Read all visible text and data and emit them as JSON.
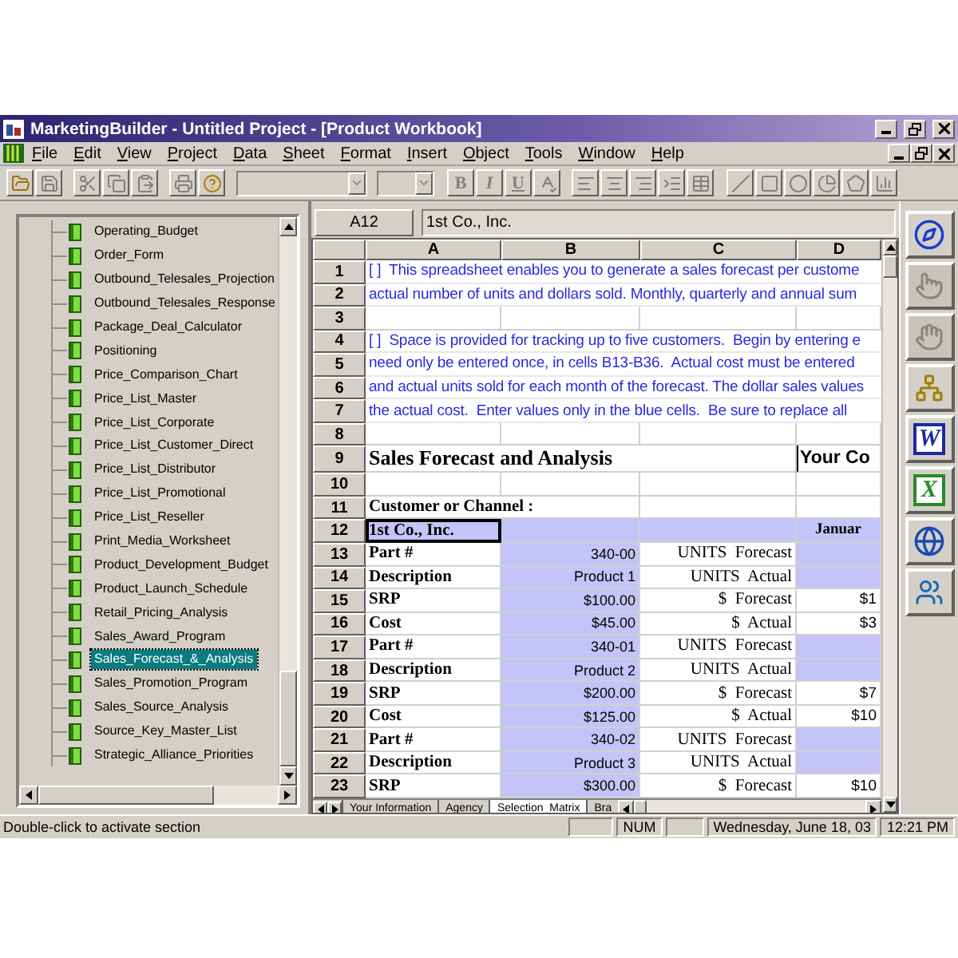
{
  "window": {
    "title": "MarketingBuilder - Untitled Project - [Product Workbook]"
  },
  "menu": [
    "File",
    "Edit",
    "View",
    "Project",
    "Data",
    "Sheet",
    "Format",
    "Insert",
    "Object",
    "Tools",
    "Window",
    "Help"
  ],
  "format_buttons": [
    "B",
    "I",
    "U"
  ],
  "sections": [
    {
      "label": "Operating_Budget",
      "selected": false
    },
    {
      "label": "Order_Form",
      "selected": false
    },
    {
      "label": "Outbound_Telesales_Projection",
      "selected": false
    },
    {
      "label": "Outbound_Telesales_Response",
      "selected": false
    },
    {
      "label": "Package_Deal_Calculator",
      "selected": false
    },
    {
      "label": "Positioning",
      "selected": false
    },
    {
      "label": "Price_Comparison_Chart",
      "selected": false
    },
    {
      "label": "Price_List_Master",
      "selected": false
    },
    {
      "label": "Price_List_Corporate",
      "selected": false
    },
    {
      "label": "Price_List_Customer_Direct",
      "selected": false
    },
    {
      "label": "Price_List_Distributor",
      "selected": false
    },
    {
      "label": "Price_List_Promotional",
      "selected": false
    },
    {
      "label": "Price_List_Reseller",
      "selected": false
    },
    {
      "label": "Print_Media_Worksheet",
      "selected": false
    },
    {
      "label": "Product_Development_Budget",
      "selected": false
    },
    {
      "label": "Product_Launch_Schedule",
      "selected": false
    },
    {
      "label": "Retail_Pricing_Analysis",
      "selected": false
    },
    {
      "label": "Sales_Award_Program",
      "selected": false
    },
    {
      "label": "Sales_Forecast_&_Analysis",
      "selected": true
    },
    {
      "label": "Sales_Promotion_Program",
      "selected": false
    },
    {
      "label": "Sales_Source_Analysis",
      "selected": false
    },
    {
      "label": "Source_Key_Master_List",
      "selected": false
    },
    {
      "label": "Strategic_Alliance_Priorities",
      "selected": false
    }
  ],
  "sheet": {
    "name_box": "A12",
    "formula": "1st Co., Inc.",
    "columns": [
      "A",
      "B",
      "C",
      "D"
    ],
    "rows": [
      {
        "number": "1",
        "kind": "note",
        "text": "[ ]  This spreadsheet enables you to generate a sales forecast per custome"
      },
      {
        "number": "2",
        "kind": "note",
        "text": "actual number of units and dollars sold. Monthly, quarterly and annual sum"
      },
      {
        "number": "3",
        "kind": "blank"
      },
      {
        "number": "4",
        "kind": "note",
        "text": "[ ]  Space is provided for tracking up to five customers.  Begin by entering e"
      },
      {
        "number": "5",
        "kind": "note",
        "text": "need only be entered once, in cells B13-B36.  Actual cost must be entered"
      },
      {
        "number": "6",
        "kind": "note",
        "text": "and actual units sold for each month of the forecast. The dollar sales values"
      },
      {
        "number": "7",
        "kind": "note",
        "text": "the actual cost.  Enter values only in the blue cells.  Be sure to replace all"
      },
      {
        "number": "8",
        "kind": "blank"
      },
      {
        "number": "9",
        "kind": "heading",
        "title": "Sales Forecast and Analysis",
        "aside": "Your Co"
      },
      {
        "number": "10",
        "kind": "blank"
      },
      {
        "number": "11",
        "kind": "form",
        "cells": [
          {
            "text": "Customer or Channel :",
            "input": false,
            "selected": false
          },
          {
            "input": false,
            "selected": false
          },
          {
            "input": false,
            "selected": false
          },
          {
            "input": false,
            "selected": false
          }
        ]
      },
      {
        "number": "12",
        "kind": "form",
        "cells": [
          {
            "text": "1st Co., Inc.",
            "input": true,
            "selected": true
          },
          {
            "input": true,
            "selected": false
          },
          {
            "input": true,
            "selected": false
          },
          {
            "text": "Januar",
            "input": true,
            "selected": false
          }
        ]
      },
      {
        "number": "13",
        "kind": "form",
        "cells": [
          {
            "text": "Part #",
            "input": false,
            "selected": false
          },
          {
            "text": "340-00",
            "input": true,
            "selected": false
          },
          {
            "text": "UNITS  Forecast",
            "input": false,
            "selected": false
          },
          {
            "input": true,
            "selected": false
          }
        ]
      },
      {
        "number": "14",
        "kind": "form",
        "cells": [
          {
            "text": "Description",
            "input": false,
            "selected": false
          },
          {
            "text": "Product 1",
            "input": true,
            "selected": false
          },
          {
            "text": "UNITS  Actual",
            "input": false,
            "selected": false
          },
          {
            "input": true,
            "selected": false
          }
        ]
      },
      {
        "number": "15",
        "kind": "form",
        "cells": [
          {
            "text": "SRP",
            "input": false,
            "selected": false
          },
          {
            "text": "$100.00",
            "input": true,
            "selected": false
          },
          {
            "text": "$  Forecast",
            "input": false,
            "selected": false
          },
          {
            "text": "$1",
            "input": false,
            "selected": false
          }
        ]
      },
      {
        "number": "16",
        "kind": "form",
        "cells": [
          {
            "text": "Cost",
            "input": false,
            "selected": false
          },
          {
            "text": "$45.00",
            "input": true,
            "selected": false
          },
          {
            "text": "$  Actual",
            "input": false,
            "selected": false
          },
          {
            "text": "$3",
            "input": false,
            "selected": false
          }
        ]
      },
      {
        "number": "17",
        "kind": "form",
        "cells": [
          {
            "text": "Part #",
            "input": false,
            "selected": false
          },
          {
            "text": "340-01",
            "input": true,
            "selected": false
          },
          {
            "text": "UNITS  Forecast",
            "input": false,
            "selected": false
          },
          {
            "input": true,
            "selected": false
          }
        ]
      },
      {
        "number": "18",
        "kind": "form",
        "cells": [
          {
            "text": "Description",
            "input": false,
            "selected": false
          },
          {
            "text": "Product 2",
            "input": true,
            "selected": false
          },
          {
            "text": "UNITS  Actual",
            "input": false,
            "selected": false
          },
          {
            "input": true,
            "selected": false
          }
        ]
      },
      {
        "number": "19",
        "kind": "form",
        "cells": [
          {
            "text": "SRP",
            "input": false,
            "selected": false
          },
          {
            "text": "$200.00",
            "input": true,
            "selected": false
          },
          {
            "text": "$  Forecast",
            "input": false,
            "selected": false
          },
          {
            "text": "$7",
            "input": false,
            "selected": false
          }
        ]
      },
      {
        "number": "20",
        "kind": "form",
        "cells": [
          {
            "text": "Cost",
            "input": false,
            "selected": false
          },
          {
            "text": "$125.00",
            "input": true,
            "selected": false
          },
          {
            "text": "$  Actual",
            "input": false,
            "selected": false
          },
          {
            "text": "$10",
            "input": false,
            "selected": false
          }
        ]
      },
      {
        "number": "21",
        "kind": "form",
        "cells": [
          {
            "text": "Part #",
            "input": false,
            "selected": false
          },
          {
            "text": "340-02",
            "input": true,
            "selected": false
          },
          {
            "text": "UNITS  Forecast",
            "input": false,
            "selected": false
          },
          {
            "input": true,
            "selected": false
          }
        ]
      },
      {
        "number": "22",
        "kind": "form",
        "cells": [
          {
            "text": "Description",
            "input": false,
            "selected": false
          },
          {
            "text": "Product 3",
            "input": true,
            "selected": false
          },
          {
            "text": "UNITS  Actual",
            "input": false,
            "selected": false
          },
          {
            "input": true,
            "selected": false
          }
        ]
      },
      {
        "number": "23",
        "kind": "form",
        "cells": [
          {
            "text": "SRP",
            "input": false,
            "selected": false
          },
          {
            "text": "$300.00",
            "input": true,
            "selected": false
          },
          {
            "text": "$  Forecast",
            "input": false,
            "selected": false
          },
          {
            "text": "$10",
            "input": false,
            "selected": false
          }
        ]
      }
    ],
    "tabs": [
      {
        "label": "Your Information",
        "selected": false
      },
      {
        "label": "Agency",
        "selected": false
      },
      {
        "label": "Selection_Matrix",
        "selected": true
      },
      {
        "label": "Bra",
        "selected": false
      }
    ]
  },
  "app_buttons": [
    {
      "kind": "compass",
      "disabled": false
    },
    {
      "kind": "hand-left",
      "disabled": true
    },
    {
      "kind": "hand-right",
      "disabled": true
    },
    {
      "kind": "org-chart",
      "disabled": false
    },
    {
      "kind": "word",
      "label": "W",
      "disabled": false
    },
    {
      "kind": "excel",
      "label": "X",
      "disabled": false
    },
    {
      "kind": "globe",
      "disabled": false
    },
    {
      "kind": "people",
      "disabled": false
    }
  ],
  "status_bar": {
    "message": "Double-click to activate section",
    "num": "NUM",
    "date": "Wednesday, June 18, 03",
    "time": "12:21 PM"
  }
}
